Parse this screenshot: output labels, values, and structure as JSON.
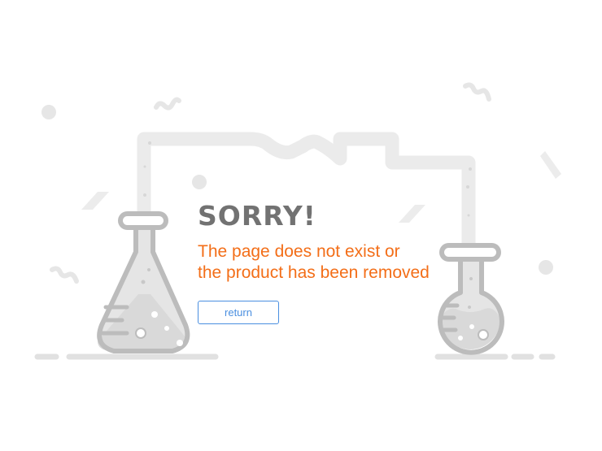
{
  "error": {
    "title": "SORRY!",
    "message_line1": "The page does not exist or",
    "message_line2": "the product has been removed",
    "return_label": "return"
  },
  "colors": {
    "title": "#727272",
    "message": "#f36e18",
    "button": "#4a8fe0",
    "illustration_pipe": "#eaeaea",
    "illustration_glass": "#bdbdbd",
    "illustration_liquid": "#dcdcdc"
  },
  "icons": {
    "left_flask": "erlenmeyer-flask-icon",
    "right_flask": "round-bottom-flask-icon"
  }
}
